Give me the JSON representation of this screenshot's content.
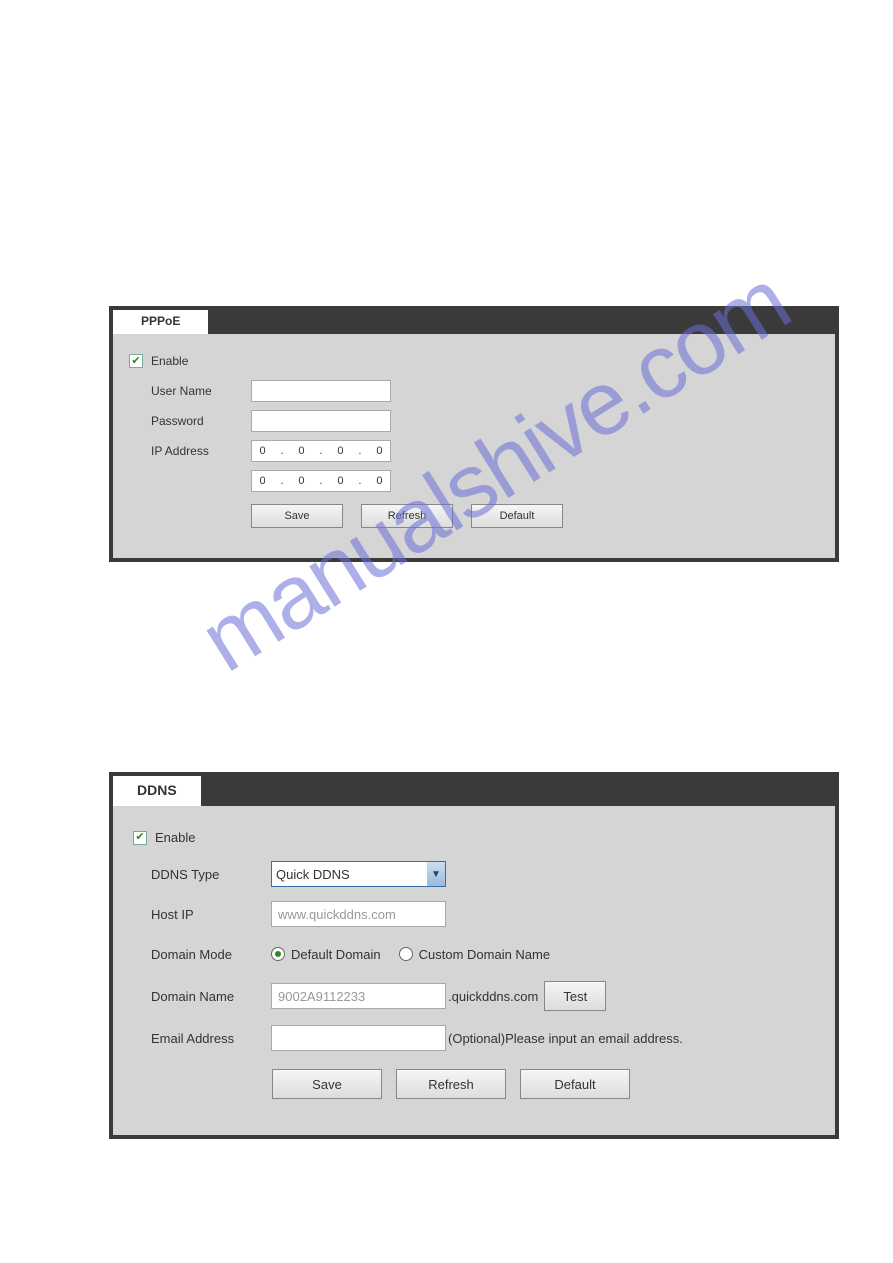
{
  "panel1": {
    "tab": "PPPoE",
    "enable_label": "Enable",
    "enable_checked": true,
    "username_label": "User Name",
    "username_value": "",
    "password_label": "Password",
    "password_value": "",
    "ip_label": "IP Address",
    "ip1": {
      "a": "0",
      "b": "0",
      "c": "0",
      "d": "0"
    },
    "ip2": {
      "a": "0",
      "b": "0",
      "c": "0",
      "d": "0"
    },
    "save_label": "Save",
    "refresh_label": "Refresh",
    "default_label": "Default"
  },
  "panel2": {
    "tab": "DDNS",
    "enable_label": "Enable",
    "enable_checked": true,
    "ddns_type_label": "DDNS Type",
    "ddns_type_value": "Quick DDNS",
    "host_ip_label": "Host IP",
    "host_ip_value": "www.quickddns.com",
    "domain_mode_label": "Domain Mode",
    "domain_mode_default": "Default Domain",
    "domain_mode_custom": "Custom Domain Name",
    "domain_name_label": "Domain Name",
    "domain_name_value": "9002A9112233",
    "domain_suffix": ".quickddns.com",
    "test_label": "Test",
    "email_label": "Email Address",
    "email_value": "",
    "email_hint": "(Optional)Please input an email address.",
    "save_label": "Save",
    "refresh_label": "Refresh",
    "default_label": "Default"
  }
}
